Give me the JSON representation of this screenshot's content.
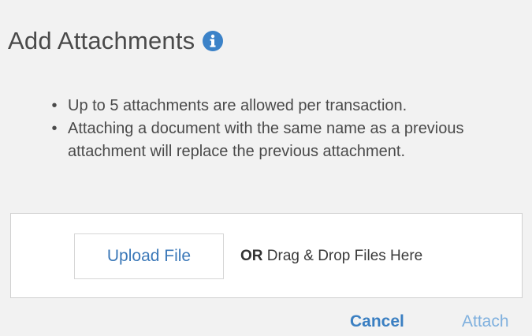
{
  "dialog": {
    "title": "Add Attachments",
    "info_icon": "info-circle-icon",
    "notes": [
      "Up to 5 attachments are allowed per transaction.",
      "Attaching a document with the same name as a previous attachment will replace the previous attachment."
    ],
    "bullet": "•",
    "upload_label": "Upload File",
    "drop_or": "OR",
    "drop_text": " Drag & Drop Files Here",
    "cancel_label": "Cancel",
    "attach_label": "Attach"
  },
  "colors": {
    "background": "#f2f2f2",
    "accent": "#3a7fc2",
    "info_icon": "#3b82c8",
    "disabled_action": "#7fb0de"
  }
}
